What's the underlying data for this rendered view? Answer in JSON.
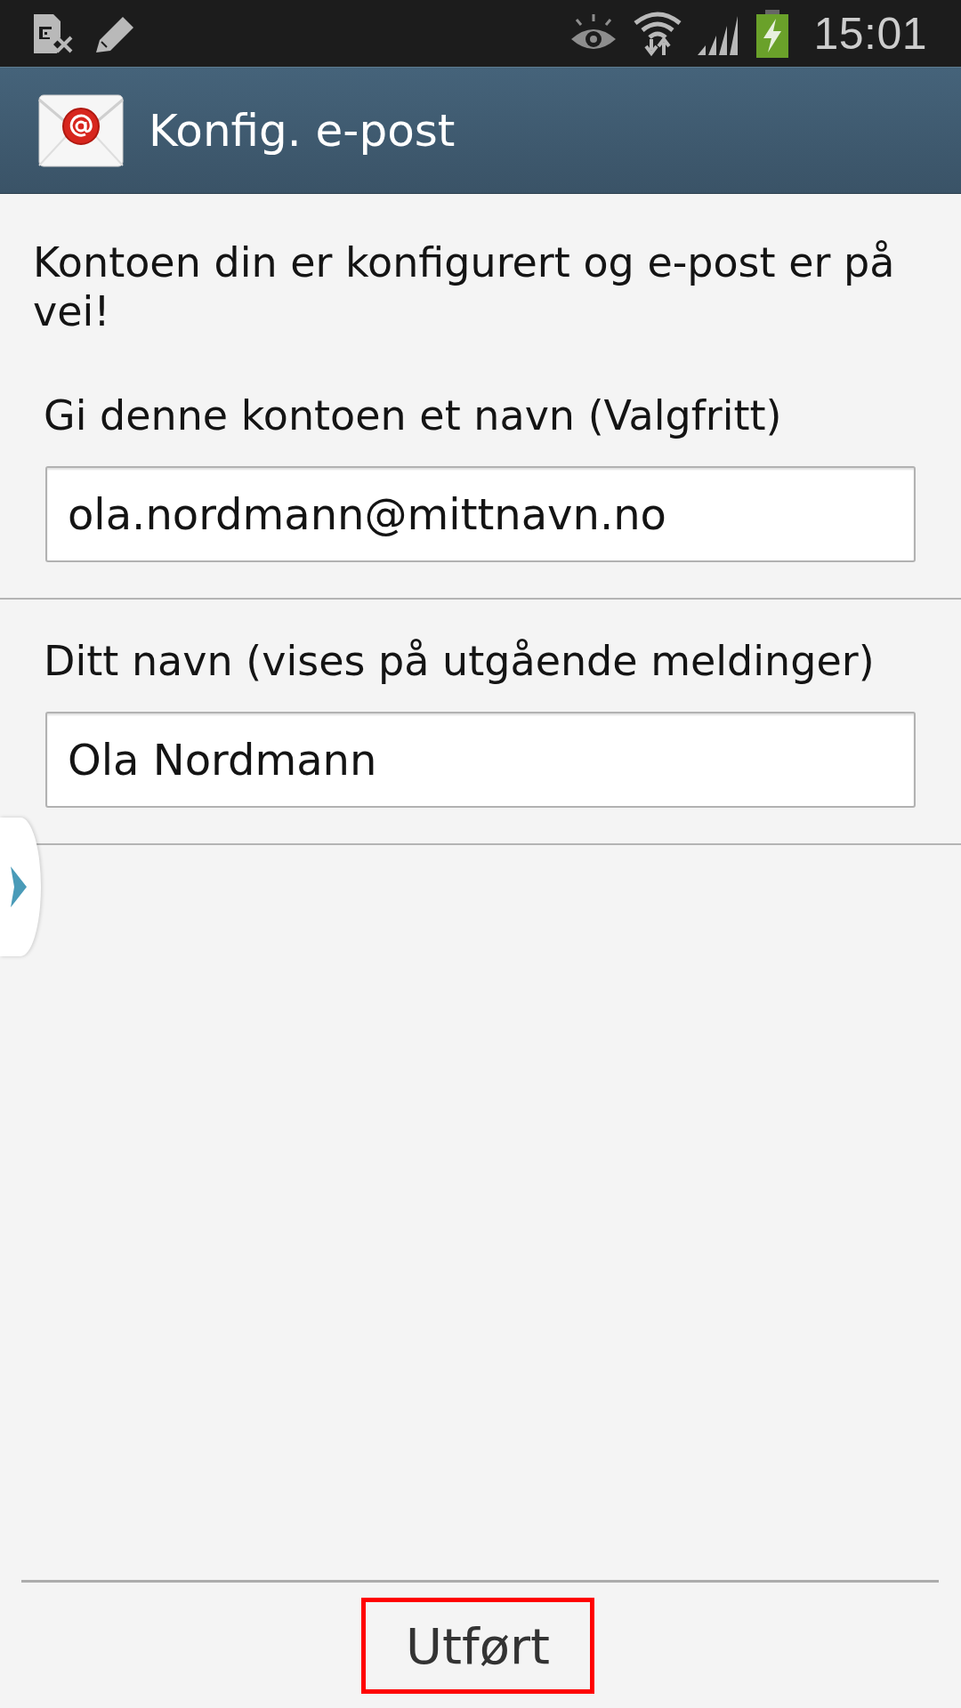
{
  "status_bar": {
    "time": "15:01"
  },
  "app_bar": {
    "title": "Konfig. e-post"
  },
  "message": "Kontoen din er konfigurert og e-post er på vei!",
  "fields": [
    {
      "label": "Gi denne kontoen et navn (Valgfritt)",
      "value": "ola.nordmann@mittnavn.no"
    },
    {
      "label": "Ditt navn (vises på utgående meldinger)",
      "value": "Ola Nordmann"
    }
  ],
  "done_button": {
    "label": "Utført",
    "highlighted": true
  }
}
